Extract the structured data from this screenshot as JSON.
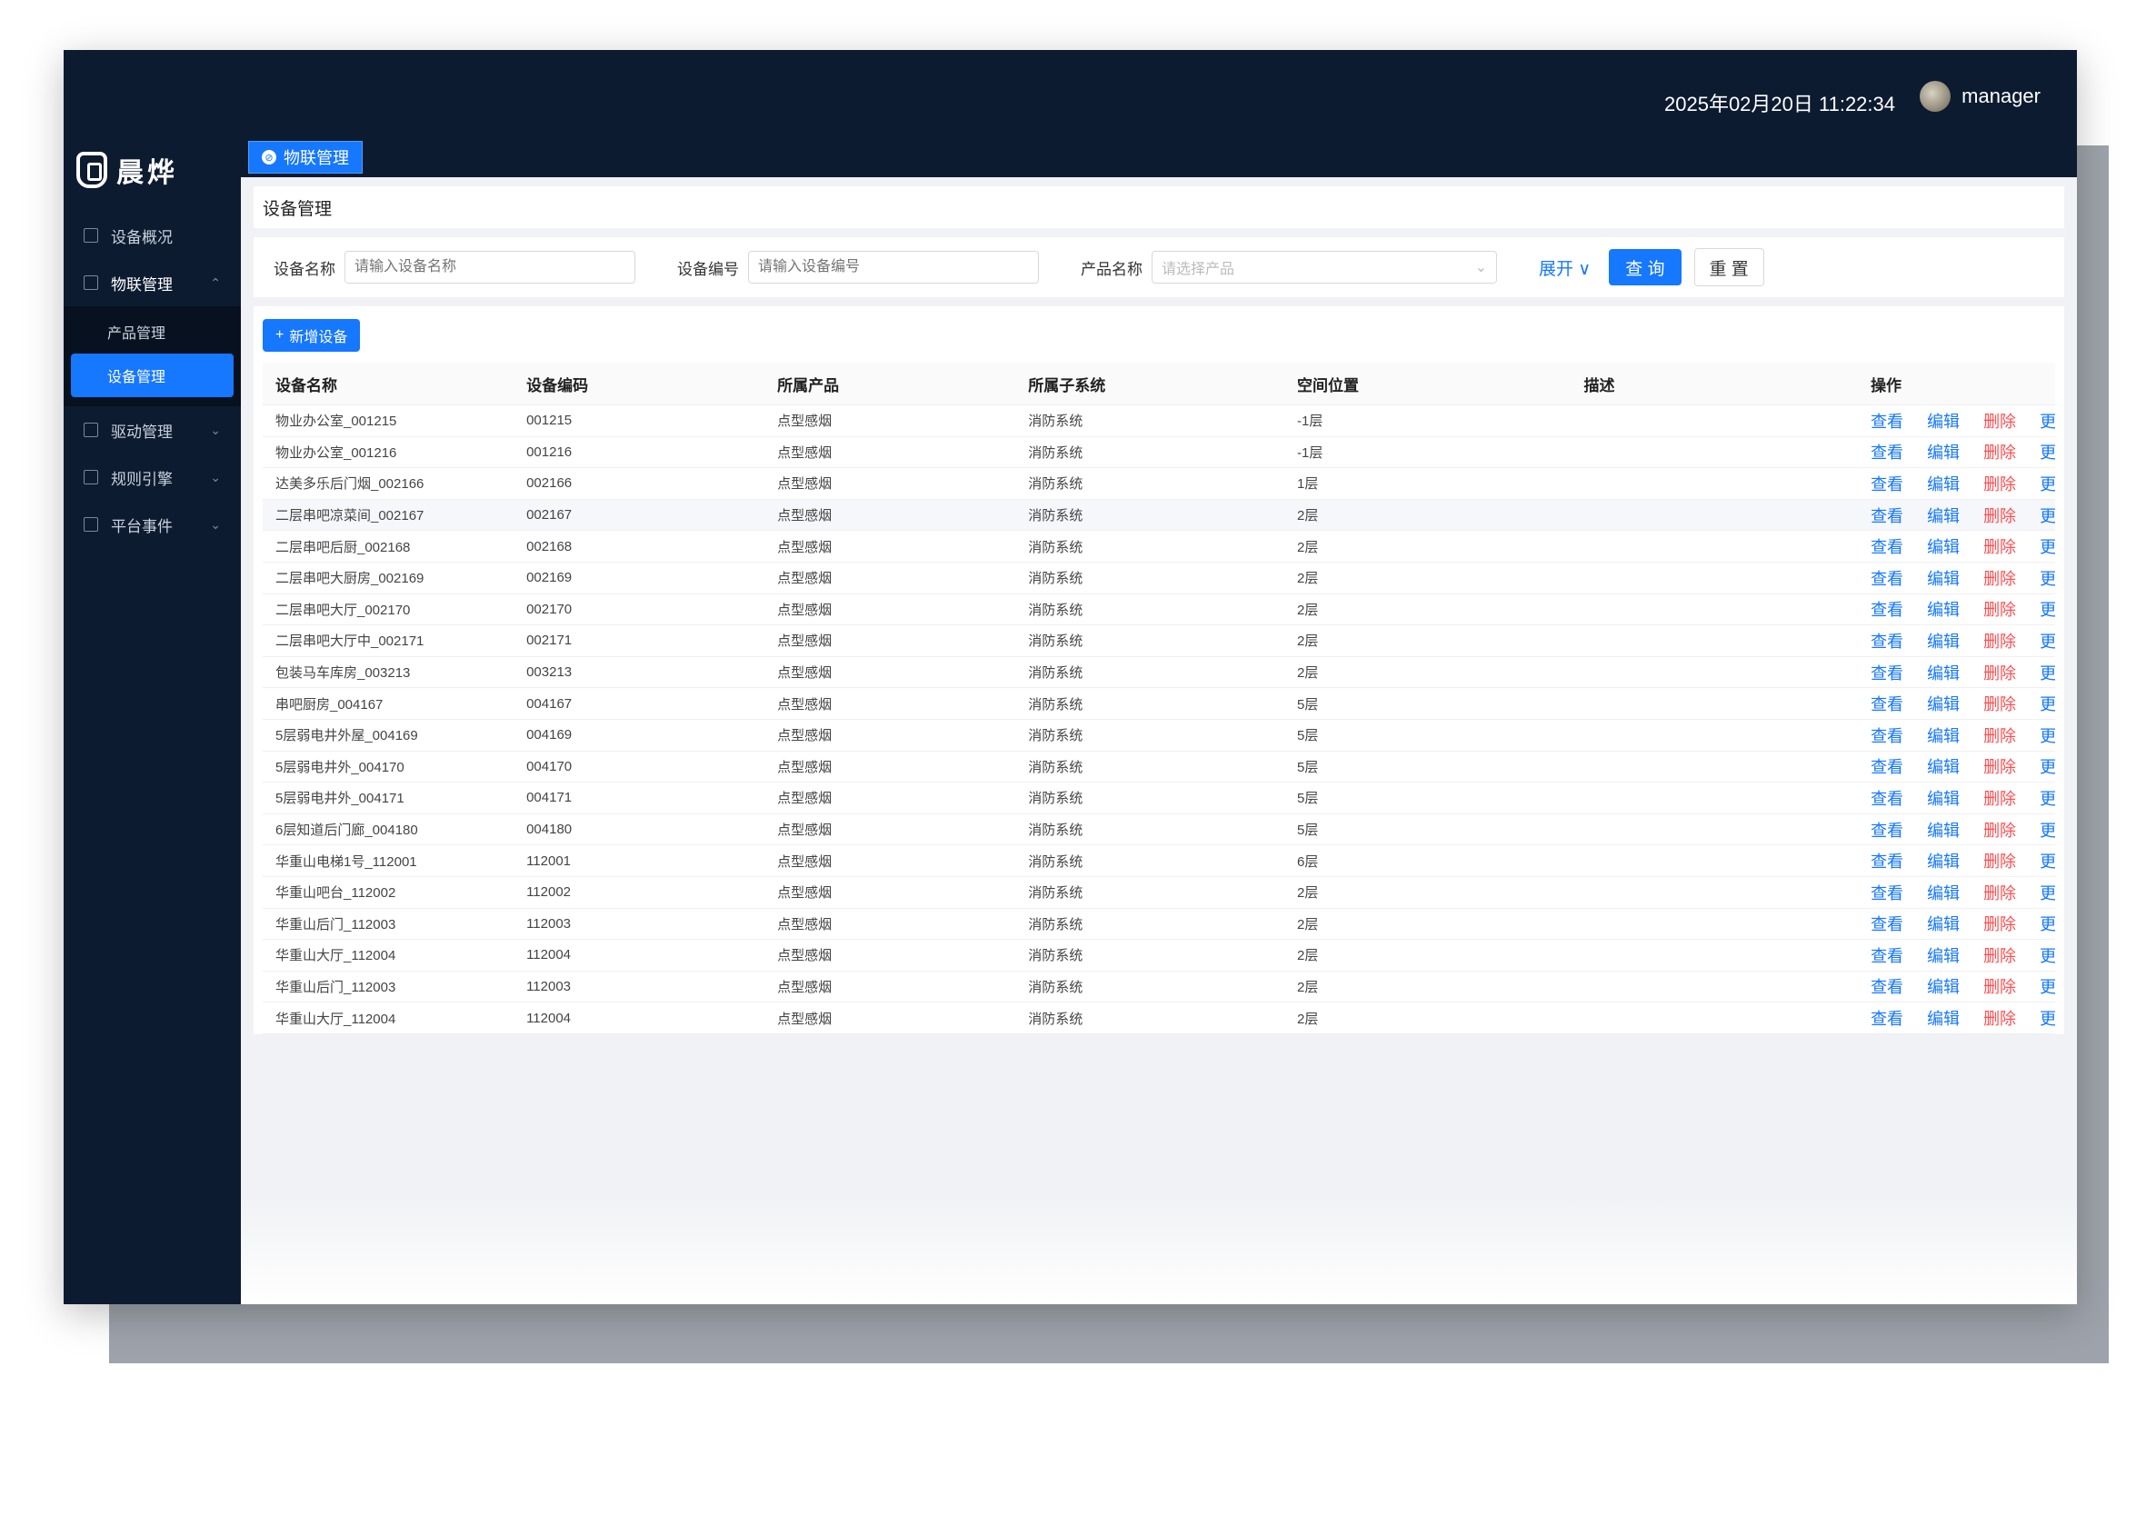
{
  "header": {
    "datetime": "2025年02月20日 11:22:34",
    "username": "manager"
  },
  "brand": {
    "name": "晨烨"
  },
  "tabs": [
    {
      "label": "物联管理"
    }
  ],
  "sidebar": {
    "items": [
      {
        "label": "设备概况",
        "icon": "dashboard-icon"
      },
      {
        "label": "物联管理",
        "icon": "iot-icon"
      },
      {
        "label": "驱动管理",
        "icon": "driver-icon"
      },
      {
        "label": "规则引擎",
        "icon": "rule-icon"
      },
      {
        "label": "平台事件",
        "icon": "event-icon"
      }
    ],
    "sub_items": [
      {
        "label": "产品管理"
      },
      {
        "label": "设备管理"
      }
    ]
  },
  "page": {
    "title": "设备管理"
  },
  "filters": {
    "device_name_label": "设备名称",
    "device_name_placeholder": "请输入设备名称",
    "device_code_label": "设备编号",
    "device_code_placeholder": "请输入设备编号",
    "product_label": "产品名称",
    "product_placeholder": "请选择产品",
    "expand_label": "展开",
    "search_label": "查 询",
    "reset_label": "重 置"
  },
  "toolbar": {
    "add_label": "新增设备"
  },
  "table": {
    "columns": [
      "设备名称",
      "设备编码",
      "所属产品",
      "所属子系统",
      "空间位置",
      "描述",
      "操作"
    ],
    "actions": {
      "view": "查看",
      "edit": "编辑",
      "delete": "删除",
      "more": "更多"
    },
    "rows": [
      {
        "name": "物业办公室_001215",
        "code": "001215",
        "product": "点型感烟",
        "subsystem": "消防系统",
        "location": "-1层",
        "desc": ""
      },
      {
        "name": "物业办公室_001216",
        "code": "001216",
        "product": "点型感烟",
        "subsystem": "消防系统",
        "location": "-1层",
        "desc": ""
      },
      {
        "name": "达美多乐后门烟_002166",
        "code": "002166",
        "product": "点型感烟",
        "subsystem": "消防系统",
        "location": "1层",
        "desc": ""
      },
      {
        "name": "二层串吧凉菜间_002167",
        "code": "002167",
        "product": "点型感烟",
        "subsystem": "消防系统",
        "location": "2层",
        "desc": ""
      },
      {
        "name": "二层串吧后厨_002168",
        "code": "002168",
        "product": "点型感烟",
        "subsystem": "消防系统",
        "location": "2层",
        "desc": ""
      },
      {
        "name": "二层串吧大厨房_002169",
        "code": "002169",
        "product": "点型感烟",
        "subsystem": "消防系统",
        "location": "2层",
        "desc": ""
      },
      {
        "name": "二层串吧大厅_002170",
        "code": "002170",
        "product": "点型感烟",
        "subsystem": "消防系统",
        "location": "2层",
        "desc": ""
      },
      {
        "name": "二层串吧大厅中_002171",
        "code": "002171",
        "product": "点型感烟",
        "subsystem": "消防系统",
        "location": "2层",
        "desc": ""
      },
      {
        "name": "包装马车库房_003213",
        "code": "003213",
        "product": "点型感烟",
        "subsystem": "消防系统",
        "location": "2层",
        "desc": ""
      },
      {
        "name": "串吧厨房_004167",
        "code": "004167",
        "product": "点型感烟",
        "subsystem": "消防系统",
        "location": "5层",
        "desc": ""
      },
      {
        "name": "5层弱电井外屋_004169",
        "code": "004169",
        "product": "点型感烟",
        "subsystem": "消防系统",
        "location": "5层",
        "desc": ""
      },
      {
        "name": "5层弱电井外_004170",
        "code": "004170",
        "product": "点型感烟",
        "subsystem": "消防系统",
        "location": "5层",
        "desc": ""
      },
      {
        "name": "5层弱电井外_004171",
        "code": "004171",
        "product": "点型感烟",
        "subsystem": "消防系统",
        "location": "5层",
        "desc": ""
      },
      {
        "name": "6层知道后门廊_004180",
        "code": "004180",
        "product": "点型感烟",
        "subsystem": "消防系统",
        "location": "5层",
        "desc": ""
      },
      {
        "name": "华重山电梯1号_112001",
        "code": "112001",
        "product": "点型感烟",
        "subsystem": "消防系统",
        "location": "6层",
        "desc": ""
      },
      {
        "name": "华重山吧台_112002",
        "code": "112002",
        "product": "点型感烟",
        "subsystem": "消防系统",
        "location": "2层",
        "desc": ""
      },
      {
        "name": "华重山后门_112003",
        "code": "112003",
        "product": "点型感烟",
        "subsystem": "消防系统",
        "location": "2层",
        "desc": ""
      },
      {
        "name": "华重山大厅_112004",
        "code": "112004",
        "product": "点型感烟",
        "subsystem": "消防系统",
        "location": "2层",
        "desc": ""
      },
      {
        "name": "华重山后门_112003",
        "code": "112003",
        "product": "点型感烟",
        "subsystem": "消防系统",
        "location": "2层",
        "desc": ""
      },
      {
        "name": "华重山大厅_112004",
        "code": "112004",
        "product": "点型感烟",
        "subsystem": "消防系统",
        "location": "2层",
        "desc": ""
      }
    ]
  },
  "colors": {
    "nav_bg": "#0d1b31",
    "primary": "#1677ff",
    "danger": "#ff4d4f"
  }
}
